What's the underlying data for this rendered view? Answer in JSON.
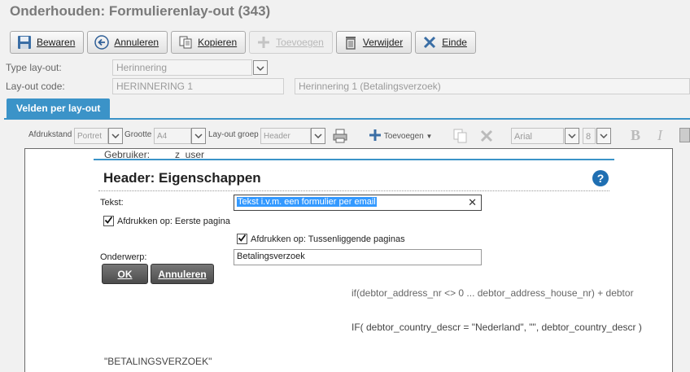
{
  "window": {
    "title": "Onderhouden: Formulierenlay-out (343)"
  },
  "toolbar": {
    "save_label": "Bewaren",
    "cancel_label": "Annuleren",
    "copy_label": "Kopieren",
    "add_label": "Toevoegen",
    "delete_label": "Verwijder",
    "end_label": "Einde"
  },
  "form": {
    "type_label": "Type lay-out:",
    "type_value": "Herinnering",
    "code_label": "Lay-out code:",
    "code_value": "HERINNERING 1",
    "code_desc": "Herinnering 1 (Betalingsverzoek)"
  },
  "tabs": {
    "active": "Velden per lay-out"
  },
  "layout_bar": {
    "orientation_label": "Afdrukstand",
    "orientation_value": "Portret",
    "size_label": "Grootte",
    "size_value": "A4",
    "group_label": "Lay-out groep",
    "group_value": "Header",
    "add_label": "Toevoegen",
    "font_value": "Arial",
    "font_size_value": "8",
    "bold_label": "B",
    "italic_label": "I"
  },
  "canvas": {
    "user_label": "Gebruiker:",
    "user_value": "z_user",
    "formula_line": "IF( debtor_country_descr = \"Nederland\", \"\", debtor_country_descr )",
    "overlap_line": "if(debtor_address_nr <> 0 ... debtor_address_house_nr) + debtor",
    "title_text": "\"BETALINGSVERZOEK\""
  },
  "dialog": {
    "title": "Header: Eigenschappen",
    "help_label": "?",
    "text_label": "Tekst:",
    "text_value": "Tekst i.v.m. een formulier per email",
    "clear_label": "✕",
    "print_first_label": "Afdrukken op: Eerste pagina",
    "print_first_checked": true,
    "print_between_label": "Afdrukken op: Tussenliggende paginas",
    "print_between_checked": true,
    "subject_label": "Onderwerp:",
    "subject_value": "Betalingsverzoek",
    "ok_label": "OK",
    "cancel_label": "Annuleren"
  },
  "colors": {
    "accent": "#3b93c8",
    "help": "#1f6fb2"
  }
}
